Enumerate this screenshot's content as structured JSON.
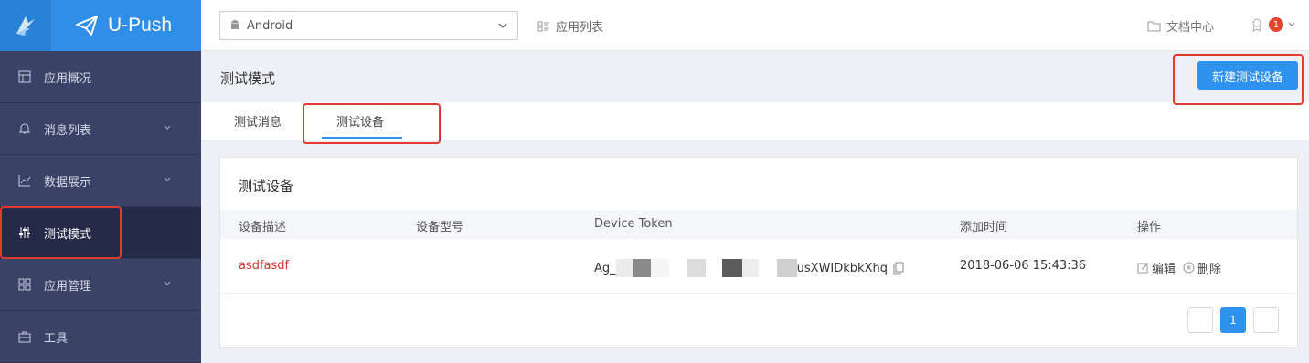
{
  "brand": {
    "name": "U-Push"
  },
  "topbar": {
    "platform": "Android",
    "app_list": "应用列表",
    "docs": "文档中心",
    "notifications": "1"
  },
  "sidebar": {
    "items": [
      {
        "label": "应用概况",
        "icon": "layout-icon"
      },
      {
        "label": "消息列表",
        "icon": "bell-icon",
        "expandable": true
      },
      {
        "label": "数据展示",
        "icon": "chart-icon",
        "expandable": true
      },
      {
        "label": "测试模式",
        "icon": "sliders-icon",
        "active": true
      },
      {
        "label": "应用管理",
        "icon": "grid-icon",
        "expandable": true
      },
      {
        "label": "工具",
        "icon": "toolbox-icon"
      }
    ]
  },
  "page": {
    "title": "测试模式",
    "new_button": "新建测试设备",
    "tabs": [
      "测试消息",
      "测试设备"
    ],
    "active_tab": "测试设备"
  },
  "card": {
    "title": "测试设备",
    "columns": [
      "设备描述",
      "设备型号",
      "Device Token",
      "添加时间",
      "操作"
    ],
    "rows": [
      {
        "desc": "asdfasdf",
        "model": "",
        "token_prefix": "Ag_",
        "token_suffix": "usXWIDkbkXhq",
        "added": "2018-06-06 15:43:36",
        "edit": "编辑",
        "delete": "删除"
      }
    ],
    "pagination": {
      "current": "1"
    }
  },
  "colors": {
    "accent": "#2f92ee",
    "sidebar": "#3a4267",
    "highlight": "#e03b2e",
    "danger": "#d9342b"
  }
}
